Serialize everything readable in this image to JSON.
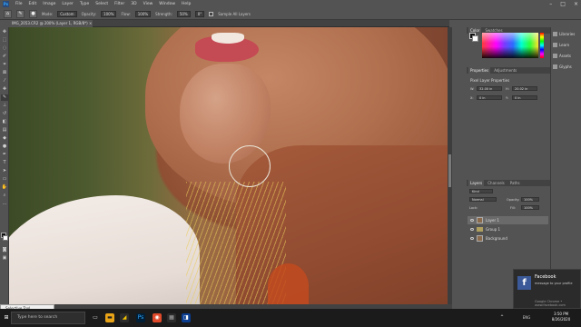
{
  "app": {
    "logo": "Ps"
  },
  "menu": [
    "File",
    "Edit",
    "Image",
    "Layer",
    "Type",
    "Select",
    "Filter",
    "3D",
    "View",
    "Window",
    "Help"
  ],
  "window_controls": [
    "–",
    "□",
    "×"
  ],
  "options_bar": {
    "mode_label": "Mode:",
    "mode_value": "Custom",
    "opacity_label": "Opacity:",
    "opacity_value": "100%",
    "flow_label": "Flow:",
    "flow_value": "100%",
    "strength_label": "Strength:",
    "strength_value": "50%",
    "sample_all_label": "Sample All Layers",
    "angle_value": "0°"
  },
  "document_tab": {
    "title": "IMG_2053.CR2 @ 200% (Layer 1, RGB/8*)",
    "close": "×"
  },
  "status_popup": {
    "label": "Selective Tool"
  },
  "panels": {
    "color": {
      "tabs": [
        "Color",
        "Swatches"
      ]
    },
    "properties": {
      "tabs": [
        "Properties",
        "Adjustments"
      ],
      "title": "Pixel Layer Properties",
      "w_label": "W:",
      "w_value": "32.00 in",
      "h_label": "H:",
      "h_value": "20.02 in",
      "x_label": "X:",
      "x_value": "0 in",
      "y_label": "Y:",
      "y_value": "0 in"
    },
    "layers": {
      "tabs": [
        "Layers",
        "Channels",
        "Paths"
      ],
      "kind_label": "Kind",
      "blend_mode": "Normal",
      "opacity_label": "Opacity:",
      "opacity_value": "100%",
      "lock_label": "Lock:",
      "fill_label": "Fill:",
      "fill_value": "100%",
      "items": [
        {
          "name": "Layer 1",
          "selected": true
        },
        {
          "name": "Group 1",
          "selected": false
        },
        {
          "name": "Background",
          "selected": false
        }
      ]
    }
  },
  "dock": [
    {
      "label": "Libraries",
      "icon": "libraries-icon"
    },
    {
      "label": "Learn",
      "icon": "learn-icon"
    },
    {
      "label": "Assets",
      "icon": "assets-icon"
    },
    {
      "label": "Glyphs",
      "icon": "glyphs-icon"
    }
  ],
  "taskbar": {
    "search_placeholder": "Type here to search",
    "time": "3:50 PM",
    "date": "8/26/2020",
    "lang": "ENG"
  },
  "toast": {
    "app": "Facebook",
    "title": "Facebook",
    "body": "message to your profile",
    "source": "Google Chrome • www.facebook.com"
  },
  "colors": {
    "chrome": "#535353",
    "dark": "#424242",
    "taskbar": "#1b1b1b",
    "accent": "#31a8ff",
    "facebook": "#3b5998"
  }
}
